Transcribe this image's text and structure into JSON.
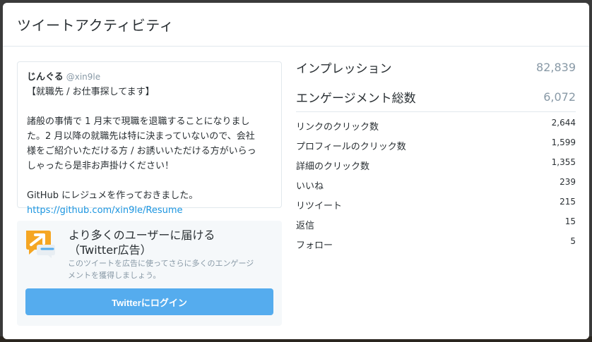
{
  "modal": {
    "title": "ツイートアクティビティ"
  },
  "tweet": {
    "name": "じんぐる",
    "handle": "@xin9le",
    "lines": [
      "【就職先 / お仕事探してます】",
      "",
      "諸般の事情で 1 月末で現職を退職することになりまし",
      "た。2 月以降の就職先は特に決まっていないので、会社",
      "様をご紹介いただける方 / お誘いいただける方がいらっ",
      "しゃったら是非お声掛けください！",
      "",
      "GitHub にレジュメを作っておきました。"
    ],
    "link": "https://github.com/xin9le/Resume"
  },
  "promo": {
    "title_line1": "より多くのユーザーに届ける",
    "title_line2": "（Twitter広告）",
    "desc_line1": "このツイートを広告に使ってさらに多くのエンゲージ",
    "desc_line2": "メントを獲得しましょう。",
    "button_label": "Twitterにログイン",
    "icon": "megaphone-chat-icon",
    "icon_color": "#f5a623",
    "accent": "#55acee"
  },
  "metrics": {
    "impressions": {
      "label": "インプレッション",
      "value": "82,839"
    },
    "engagements": {
      "label": "エンゲージメント総数",
      "value": "6,072"
    },
    "items": [
      {
        "label": "リンクのクリック数",
        "value": "2,644"
      },
      {
        "label": "プロフィールのクリック数",
        "value": "1,599"
      },
      {
        "label": "詳細のクリック数",
        "value": "1,355"
      },
      {
        "label": "いいね",
        "value": "239"
      },
      {
        "label": "リツイート",
        "value": "215"
      },
      {
        "label": "返信",
        "value": "15"
      },
      {
        "label": "フォロー",
        "value": "5"
      }
    ]
  }
}
